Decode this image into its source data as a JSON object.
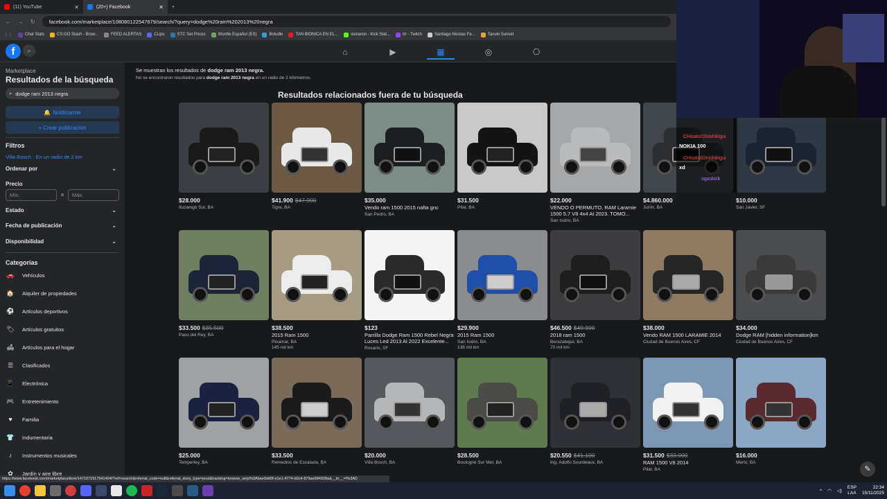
{
  "browser": {
    "tabs": [
      {
        "label": "(11) YouTube",
        "color": "#ff0000"
      },
      {
        "label": "(20+) Facebook",
        "color": "#1877f2"
      }
    ],
    "url": "facebook.com/marketplace/108060122547679/search/?query=dodge%20ram%202013%20negra",
    "bookmarks": [
      "Chat Stats",
      "CS:GO Stash - Brow...",
      "FEED ALERTAS",
      "CLips",
      "STC Set Prices",
      "Wordle Español (ES)",
      "Boludle",
      "TAN BIONICA EN EL...",
      "sionaron - Kick Stat...",
      "trr - Twitch",
      "Santiago Nicolas Fe...",
      "Tanuki Sunset"
    ]
  },
  "sidebar": {
    "crumb": "Marketplace",
    "title": "Resultados de la búsqueda",
    "search_value": "dodge ram 2013 negra",
    "notify_label": "Notificarme",
    "create_label": "+ Crear publicación",
    "filters_title": "Filtros",
    "location": "Villa Bosch · En un radio de 2 km",
    "sort_label": "Ordenar por",
    "price_label": "Precio",
    "min_placeholder": "Mín.",
    "max_placeholder": "Máx.",
    "price_sep": "a",
    "state_label": "Estado",
    "date_label": "Fecha de publicación",
    "availability_label": "Disponibilidad",
    "categories_title": "Categorías",
    "categories": [
      {
        "label": "Vehículos",
        "icon": "car-icon",
        "glyph": "🚗"
      },
      {
        "label": "Alquiler de propiedades",
        "icon": "house-icon",
        "glyph": "🏠"
      },
      {
        "label": "Artículos deportivos",
        "icon": "sports-icon",
        "glyph": "⚽"
      },
      {
        "label": "Artículos gratuitos",
        "icon": "tag-icon",
        "glyph": "🏷"
      },
      {
        "label": "Artículos para el hogar",
        "icon": "home-goods-icon",
        "glyph": "🛋"
      },
      {
        "label": "Clasificados",
        "icon": "classifieds-icon",
        "glyph": "☰"
      },
      {
        "label": "Electrónica",
        "icon": "phone-icon",
        "glyph": "📱"
      },
      {
        "label": "Entretenimiento",
        "icon": "entertainment-icon",
        "glyph": "🎮"
      },
      {
        "label": "Familia",
        "icon": "heart-icon",
        "glyph": "♥"
      },
      {
        "label": "Indumentaria",
        "icon": "shirt-icon",
        "glyph": "👕"
      },
      {
        "label": "Instrumentos musicales",
        "icon": "music-icon",
        "glyph": "♪"
      },
      {
        "label": "Jardín y aire libre",
        "icon": "garden-icon",
        "glyph": "✿"
      }
    ]
  },
  "main": {
    "msg1_pre": "Se muestran los resultados de ",
    "msg1_query": "dodge ram 2013 negra.",
    "msg2_pre": "No se encontraron resultados para ",
    "msg2_query": "dodge ram 2013 negra",
    "msg2_post": " en un radio de 2 kilómetros.",
    "related_title": "Resultados relacionados fuera de tu búsqueda",
    "listings": [
      {
        "price": "$28.000",
        "old": "",
        "title": "",
        "loc": "Ituzaingó Sur, BA",
        "km": "",
        "bg": "#3b3f45",
        "car": "#1a1a1a",
        "grille": "#222"
      },
      {
        "price": "$41.900",
        "old": "$47.900",
        "title": "",
        "loc": "Tigre, BA",
        "km": "",
        "bg": "#6d5a45",
        "car": "#e8e8e8",
        "grille": "#333"
      },
      {
        "price": "$35.000",
        "old": "",
        "title": "Vendo ram 1500 2015 nafta gnc",
        "loc": "San Pedro, BA",
        "km": "",
        "bg": "#7c8c86",
        "car": "#1c1f22",
        "grille": "#111"
      },
      {
        "price": "$31.500",
        "old": "",
        "title": "",
        "loc": "Pilar, BA",
        "km": "",
        "bg": "#c9c9c9",
        "car": "#141414",
        "grille": "#222"
      },
      {
        "price": "$22.000",
        "old": "",
        "title": "VENDO O PERMUTO, RAM Laramie 1500 5.7 V8 4x4 At 2023. TOMO...",
        "loc": "San Isidro, BA",
        "km": "",
        "bg": "#a5a7a8",
        "car": "#b9bbbd",
        "grille": "#444"
      },
      {
        "price": "$4.860.000",
        "old": "",
        "title": "",
        "loc": "Junín, BA",
        "km": "",
        "bg": "#40464c",
        "car": "#2b2d30",
        "grille": "#111"
      },
      {
        "price": "$10.000",
        "old": "",
        "title": "",
        "loc": "San Javier, SF",
        "km": "",
        "bg": "#2f3844",
        "car": "#1b2230",
        "grille": "#111"
      },
      {
        "price": "$33.500",
        "old": "$35.500",
        "title": "",
        "loc": "Paso del Rey, BA",
        "km": "",
        "bg": "#6e7f62",
        "car": "#1c2538",
        "grille": "#222"
      },
      {
        "price": "$38.500",
        "old": "",
        "title": "2015 Ram 1500",
        "loc": "Pinamar, BA",
        "km": "145 mil km",
        "bg": "#a89b83",
        "car": "#ececec",
        "grille": "#222"
      },
      {
        "price": "$123",
        "old": "",
        "title": "Parrilla Dodge Ram 1500 Rebel Negra Luces Led 2013 Al 2022 Excelente...",
        "loc": "Rosario, SF",
        "km": "",
        "bg": "#f5f5f5",
        "car": "#2a2a2a",
        "grille": "#111"
      },
      {
        "price": "$29.900",
        "old": "",
        "title": "2015 Ram 1500",
        "loc": "San Isidro, BA",
        "km": "136 mil km",
        "bg": "#8a8c90",
        "car": "#1f4fa8",
        "grille": "#ccc"
      },
      {
        "price": "$46.500",
        "old": "$49.900",
        "title": "2018 ram 1500",
        "loc": "Berazategui, BA",
        "km": "70 mil km",
        "bg": "#3d3d3f",
        "car": "#1e1e1e",
        "grille": "#111"
      },
      {
        "price": "$38.000",
        "old": "",
        "title": "Vendo RAM 1500 LARAMIE 2014",
        "loc": "Ciudad de Buenos Aires, CF",
        "km": "",
        "bg": "#8f7a63",
        "car": "#262626",
        "grille": "#aaa"
      },
      {
        "price": "$34.000",
        "old": "",
        "title": "Dodge RAM [hidden information]km",
        "loc": "Ciudad de Buenos Aires, CF",
        "km": "",
        "bg": "#4a4c50",
        "car": "#3a3a3a",
        "grille": "#999"
      },
      {
        "price": "$25.000",
        "old": "",
        "title": "",
        "loc": "Temperley, BA",
        "km": "",
        "bg": "#9fa1a3",
        "car": "#1a2240",
        "grille": "#222"
      },
      {
        "price": "$33.500",
        "old": "",
        "title": "",
        "loc": "Remedios de Escalada, BA",
        "km": "",
        "bg": "#7a6a5a",
        "car": "#1b1b1b",
        "grille": "#ccc"
      },
      {
        "price": "$20.000",
        "old": "",
        "title": "",
        "loc": "Villa Bosch, BA",
        "km": "",
        "bg": "#55585c",
        "car": "#b5b6b8",
        "grille": "#333"
      },
      {
        "price": "$28.500",
        "old": "",
        "title": "",
        "loc": "Boulogne Sur Mer, BA",
        "km": "",
        "bg": "#5e7a4e",
        "car": "#4a4a46",
        "grille": "#222"
      },
      {
        "price": "$20.550",
        "old": "$41.100",
        "title": "",
        "loc": "Ing. Adolfo Sourdeaux, BA",
        "km": "",
        "bg": "#2f3136",
        "car": "#202126",
        "grille": "#aaa"
      },
      {
        "price": "$31.500",
        "old": "$33.000",
        "title": "RAM 1500 V8 2014",
        "loc": "Pilar, BA",
        "km": "",
        "bg": "#7c96b4",
        "car": "#f2f2f2",
        "grille": "#333"
      },
      {
        "price": "$16.000",
        "old": "",
        "title": "",
        "loc": "Merlo, BA",
        "km": "",
        "bg": "#8da6c6",
        "car": "#5a2a2e",
        "grille": "#333"
      }
    ]
  },
  "stream_chat": {
    "user1": "CHisato02nishikigui",
    "msg1": "NOKIA 100",
    "user2": "CHisato02nishikigui",
    "msg2": "xd",
    "user3": "ogaskick"
  },
  "status_url": "https://www.facebook.com/marketplace/item/1471072917541404/?ref=search&referral_code=null&referral_story_type=post&tracking=browse_serp%3Abae0dd0f-e1e1-4774-b0c4-879ae984928a&__tn__=!%3AD",
  "tray": {
    "lang": "ESP",
    "lang2": "LAA",
    "time": "22:34",
    "date": "15/11/2025"
  }
}
